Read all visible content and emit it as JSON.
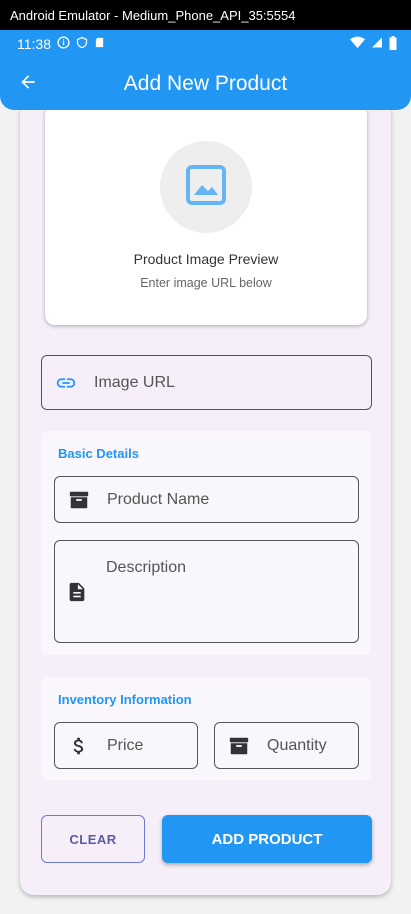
{
  "emulator": {
    "title": "Android Emulator - Medium_Phone_API_35:5554"
  },
  "status": {
    "time": "11:38"
  },
  "appbar": {
    "title": "Add New Product"
  },
  "preview": {
    "title": "Product Image Preview",
    "subtitle": "Enter image URL below"
  },
  "image_url": {
    "label": "Image URL"
  },
  "basic": {
    "title": "Basic Details",
    "product_name_label": "Product Name",
    "description_label": "Description"
  },
  "inventory": {
    "title": "Inventory Information",
    "price_label": "Price",
    "quantity_label": "Quantity"
  },
  "buttons": {
    "clear": "CLEAR",
    "add": "ADD PRODUCT"
  },
  "colors": {
    "primary": "#2196f3",
    "card_bg": "#f6eff9"
  }
}
